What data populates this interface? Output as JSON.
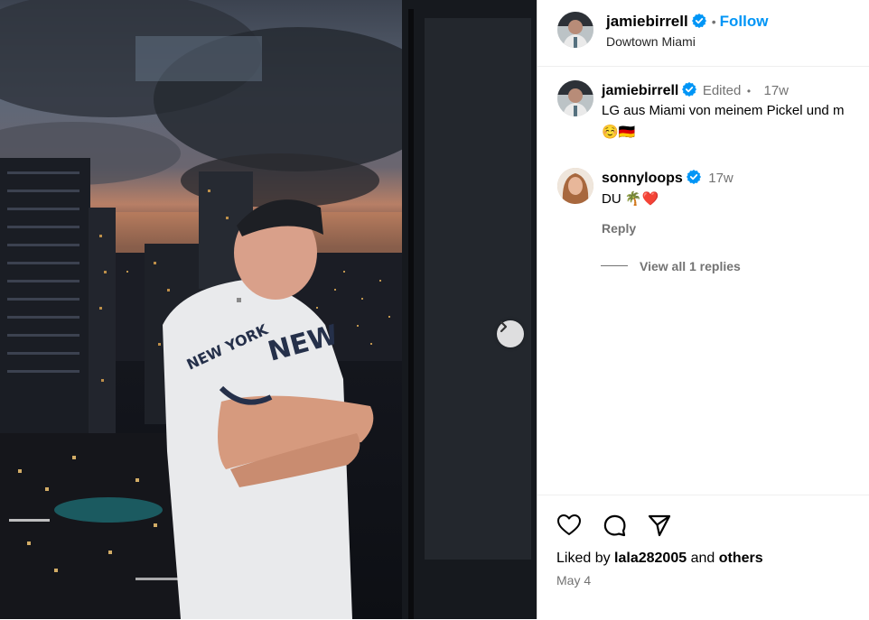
{
  "post": {
    "author": "jamiebirrell",
    "follow_label": "Follow",
    "location": "Dowtown Miami",
    "dot": "•"
  },
  "caption": {
    "author": "jamiebirrell",
    "edited_label": "Edited",
    "dot": "•",
    "time": "17w",
    "text": "LG aus Miami von meinem Pickel und m",
    "text_line2": "☺️🇩🇪"
  },
  "comments": [
    {
      "author": "sonnyloops",
      "time": "17w",
      "text": "DU 🌴❤️",
      "reply_label": "Reply",
      "view_replies_label": "View all 1 replies"
    }
  ],
  "likes": {
    "prefix": "Liked by",
    "user": "lala282005",
    "and": "and",
    "others": "others"
  },
  "date": "May 4",
  "icons": [
    "heart-icon",
    "comment-icon",
    "share-icon",
    "verified-icon",
    "chevron-right-icon"
  ],
  "colors": {
    "accent": "#0095f6",
    "muted": "#737373",
    "verified": "#0095f6"
  }
}
